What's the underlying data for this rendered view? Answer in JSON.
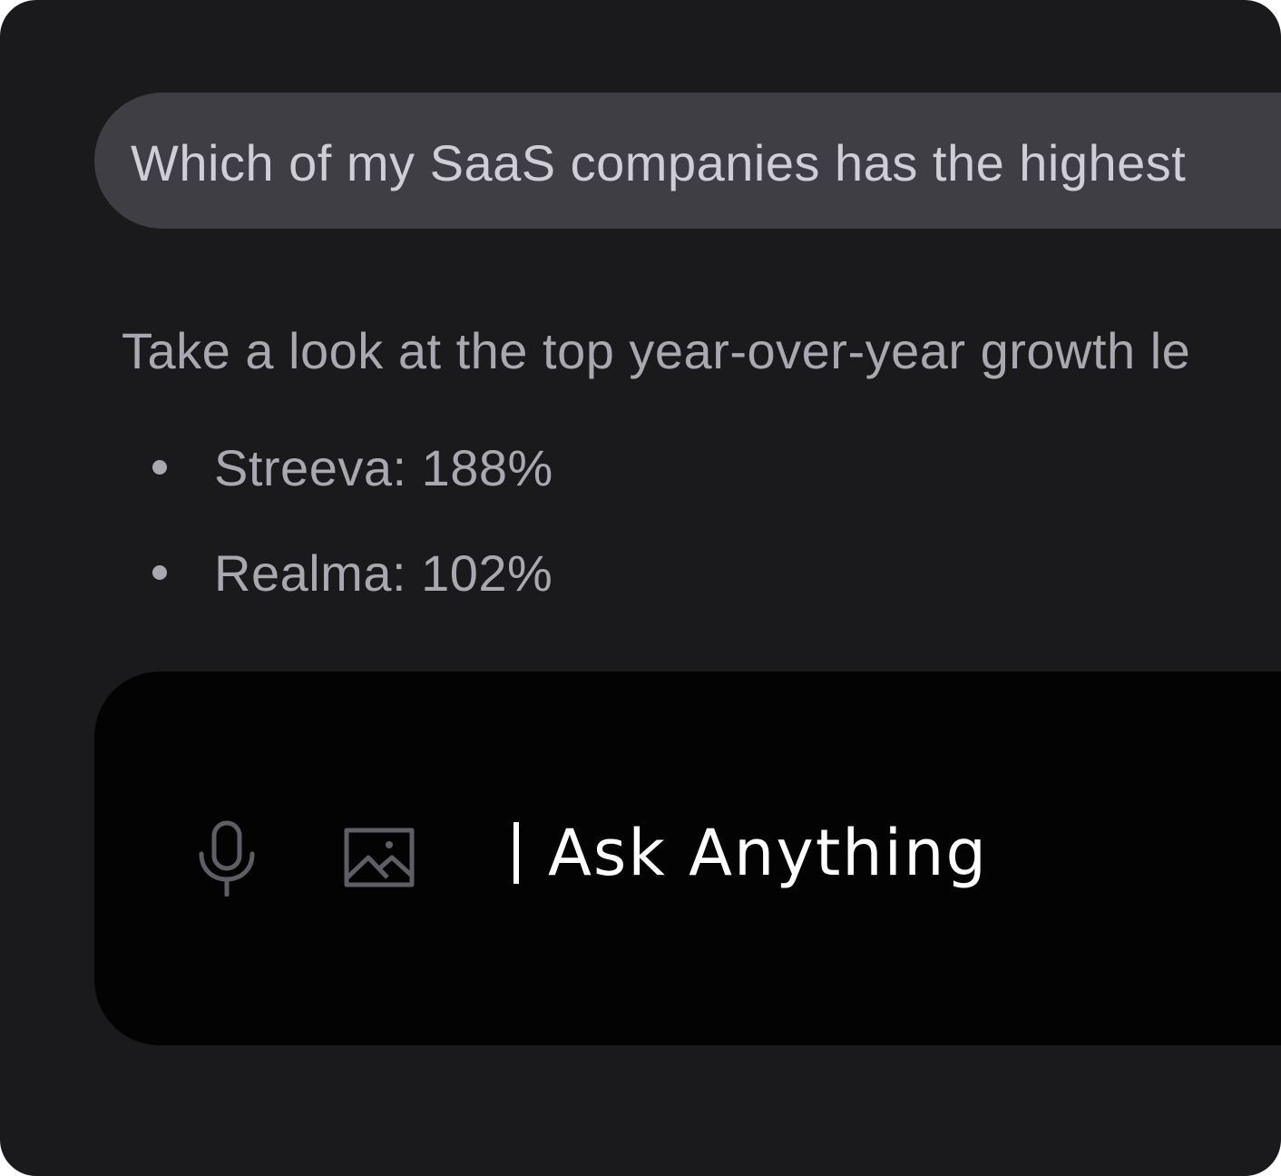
{
  "conversation": {
    "user_message": "Which of my SaaS companies has the highest",
    "assistant_intro": "Take a look at the top year-over-year growth le",
    "growth_items": [
      {
        "label": "Streeva: 188%"
      },
      {
        "label": "Realma: 102%"
      }
    ]
  },
  "composer": {
    "placeholder": "Ask Anything",
    "icons": {
      "voice": "microphone-icon",
      "attach": "image-icon"
    }
  },
  "colors": {
    "background": "#1a1a1d",
    "bubble": "#3f3e45",
    "composer": "#030303",
    "text_primary": "#cfced6",
    "text_secondary": "#a9a8b0",
    "icon": "#5f5e66",
    "input_text": "#ffffff"
  }
}
